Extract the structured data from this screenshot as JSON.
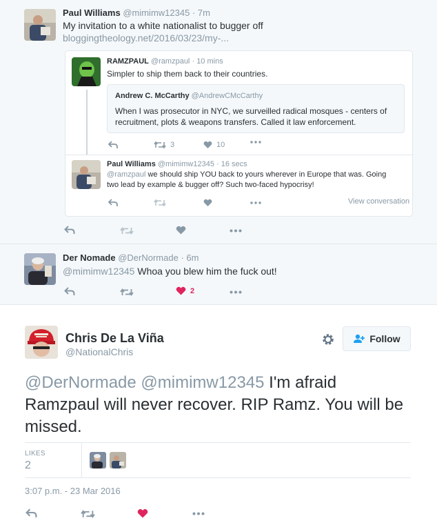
{
  "tweet_paul": {
    "name": "Paul Williams",
    "handle": "@mimimw12345",
    "separator": "·",
    "time": "7m",
    "text": "My invitation to a white nationalist to bugger off",
    "link": "bloggingtheology.net/2016/03/23/my-..."
  },
  "quoted_ramz": {
    "name": "RAMZPAUL",
    "handle": "@ramzpaul",
    "separator": "·",
    "time": "10 mins",
    "text": "Simpler to ship them back to their countries.",
    "retweets": "3",
    "likes": "10"
  },
  "quoted_mccarthy": {
    "name": "Andrew C. McCarthy",
    "handle": "@AndrewCMcCarthy",
    "text": "When I was prosecutor in NYC, we surveilled radical mosques - centers of recruitment, plots & weapons transfers. Called it law enforcement."
  },
  "quoted_reply": {
    "name": "Paul Williams",
    "handle": "@mimimw12345",
    "separator": "·",
    "time": "16 secs",
    "mention": "@ramzpaul",
    "text": " we should ship YOU back to yours wherever in Europe that was. Going two lead by example & bugger off? Such two-faced hypocrisy!",
    "view_conversation": "View conversation"
  },
  "tweet_nomade": {
    "name": "Der Nomade",
    "handle": "@DerNormade",
    "separator": "·",
    "time": "6m",
    "mention": "@mimimw12345",
    "text": " Whoa you blew him the fuck out!",
    "likes": "2"
  },
  "main_tweet": {
    "name": "Chris De La Viña",
    "handle": "@NationalChris",
    "follow_label": "Follow",
    "mention1": "@DerNormade",
    "mention2": "@mimimw12345",
    "text": " I'm afraid Ramzpaul will never recover. RIP Ramz. You will be missed.",
    "likes_label": "LIKES",
    "likes_count": "2",
    "timestamp": "3:07 p.m. - 23 Mar 2016"
  },
  "icons": [
    "reply-icon",
    "retweet-icon",
    "like-icon",
    "more-icon",
    "gear-icon",
    "follow-user-icon"
  ],
  "colors": {
    "muted": "#8899a6",
    "like_red": "#e0245e",
    "follow_blue": "#1da1f2",
    "thread_bg": "#f5f8fa"
  }
}
